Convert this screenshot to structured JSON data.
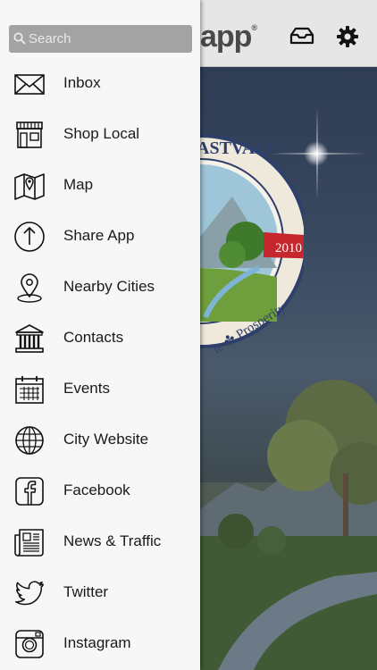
{
  "header": {
    "brand": "app",
    "brand_mark": "®",
    "inbox_icon": "inbox-tray-icon",
    "settings_icon": "gear-icon"
  },
  "seal": {
    "arc_text": "ASTVALE",
    "ribbon_year": "2010",
    "bottom_text": "le ✤ Prosperity"
  },
  "drawer": {
    "search": {
      "placeholder": "Search",
      "icon": "search-icon"
    },
    "items": [
      {
        "label": "Inbox",
        "icon": "envelope-icon"
      },
      {
        "label": "Shop Local",
        "icon": "storefront-icon"
      },
      {
        "label": "Map",
        "icon": "map-icon"
      },
      {
        "label": "Share App",
        "icon": "share-icon"
      },
      {
        "label": "Nearby Cities",
        "icon": "location-pin-icon"
      },
      {
        "label": "Contacts",
        "icon": "building-icon"
      },
      {
        "label": "Events",
        "icon": "calendar-icon"
      },
      {
        "label": "City Website",
        "icon": "globe-icon"
      },
      {
        "label": "Facebook",
        "icon": "facebook-icon"
      },
      {
        "label": "News & Traffic",
        "icon": "newspaper-icon"
      },
      {
        "label": "Twitter",
        "icon": "twitter-icon"
      },
      {
        "label": "Instagram",
        "icon": "instagram-icon"
      }
    ]
  }
}
